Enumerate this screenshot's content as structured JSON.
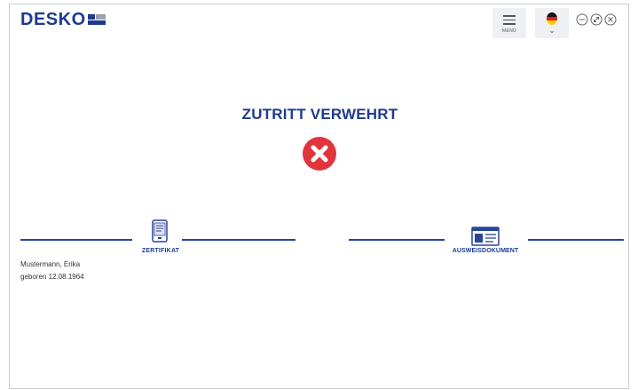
{
  "header": {
    "logo_text": "DESKO",
    "menu_label": "MENÜ",
    "language_flag": "de-flag-icon",
    "language_chevron": "⌄"
  },
  "status": {
    "title": "ZUTRITT VERWEHRT",
    "icon": "denied-x-icon",
    "color": "#e1343c"
  },
  "steps": {
    "certificate_label": "ZERTIFIKAT",
    "id_document_label": "AUSWEISDOKUMENT"
  },
  "person": {
    "name": "Mustermann, Erika",
    "birth": "geboren 12.08.1964"
  },
  "colors": {
    "brand": "#1e3b8f",
    "error": "#e1343c",
    "topbar_button_bg": "#eef0f3"
  }
}
